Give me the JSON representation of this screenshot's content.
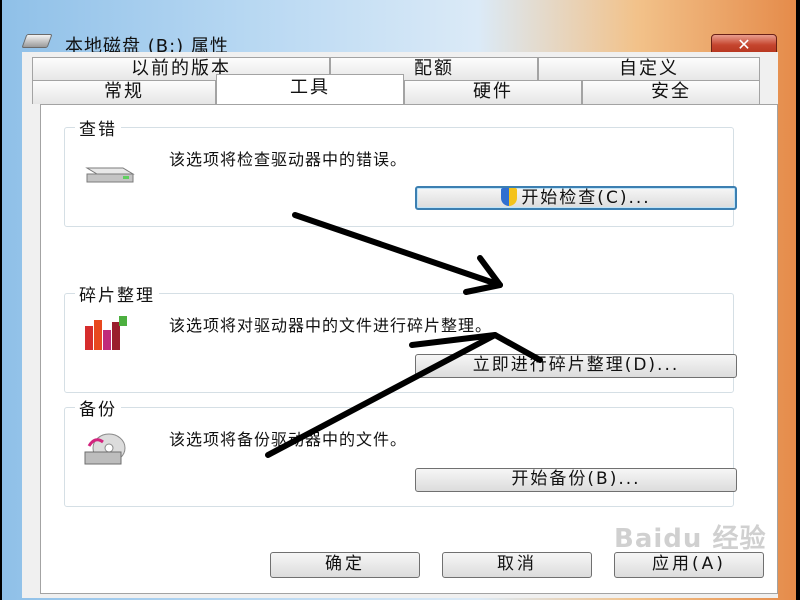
{
  "window": {
    "title": "本地磁盘 (B:) 属性",
    "close_glyph": "✕"
  },
  "tabs": {
    "row1": [
      "以前的版本",
      "配额",
      "自定义"
    ],
    "row2": [
      "常规",
      "工具",
      "硬件",
      "安全"
    ],
    "active": "工具"
  },
  "groups": {
    "check": {
      "label": "查错",
      "description": "该选项将检查驱动器中的错误。",
      "button": "开始检查(C)...",
      "icon": "drive-icon"
    },
    "defrag": {
      "label": "碎片整理",
      "description": "该选项将对驱动器中的文件进行碎片整理。",
      "button": "立即进行碎片整理(D)...",
      "icon": "defrag-icon"
    },
    "backup": {
      "label": "备份",
      "description": "该选项将备份驱动器中的文件。",
      "button": "开始备份(B)...",
      "icon": "backup-icon"
    }
  },
  "footer": {
    "ok": "确定",
    "cancel": "取消",
    "apply": "应用(A)"
  },
  "watermark": "Baidu 经验",
  "colors": {
    "accent_border": "#3c7fb1",
    "close_red": "#c5452e",
    "dialog_bg": "#f0f0f0"
  }
}
